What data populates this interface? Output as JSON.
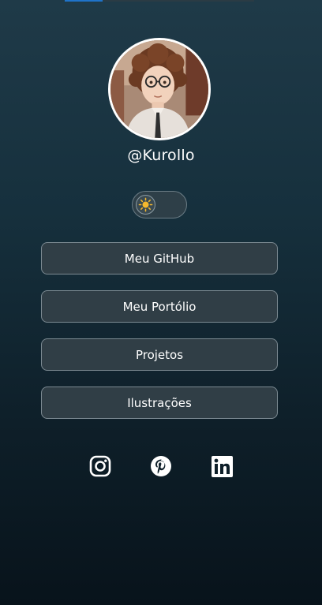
{
  "page": {
    "loading_progress": 0.2
  },
  "profile": {
    "username": "@Kurollo",
    "avatar_icon": "avatar-illustration"
  },
  "theme_toggle": {
    "icon": "sun-icon",
    "state": "light"
  },
  "links": [
    {
      "label": "Meu GitHub"
    },
    {
      "label": "Meu Portólio"
    },
    {
      "label": "Projetos"
    },
    {
      "label": "Ilustrações"
    }
  ],
  "socials": [
    {
      "icon": "instagram-icon"
    },
    {
      "icon": "pinterest-icon"
    },
    {
      "icon": "linkedin-icon"
    }
  ],
  "colors": {
    "background_top": "#1f3a48",
    "background_bottom": "#08131b",
    "button_bg": "#303e46",
    "button_border": "#7c8a92",
    "progress": "#1f73c9",
    "sun": "#f5b82e"
  }
}
